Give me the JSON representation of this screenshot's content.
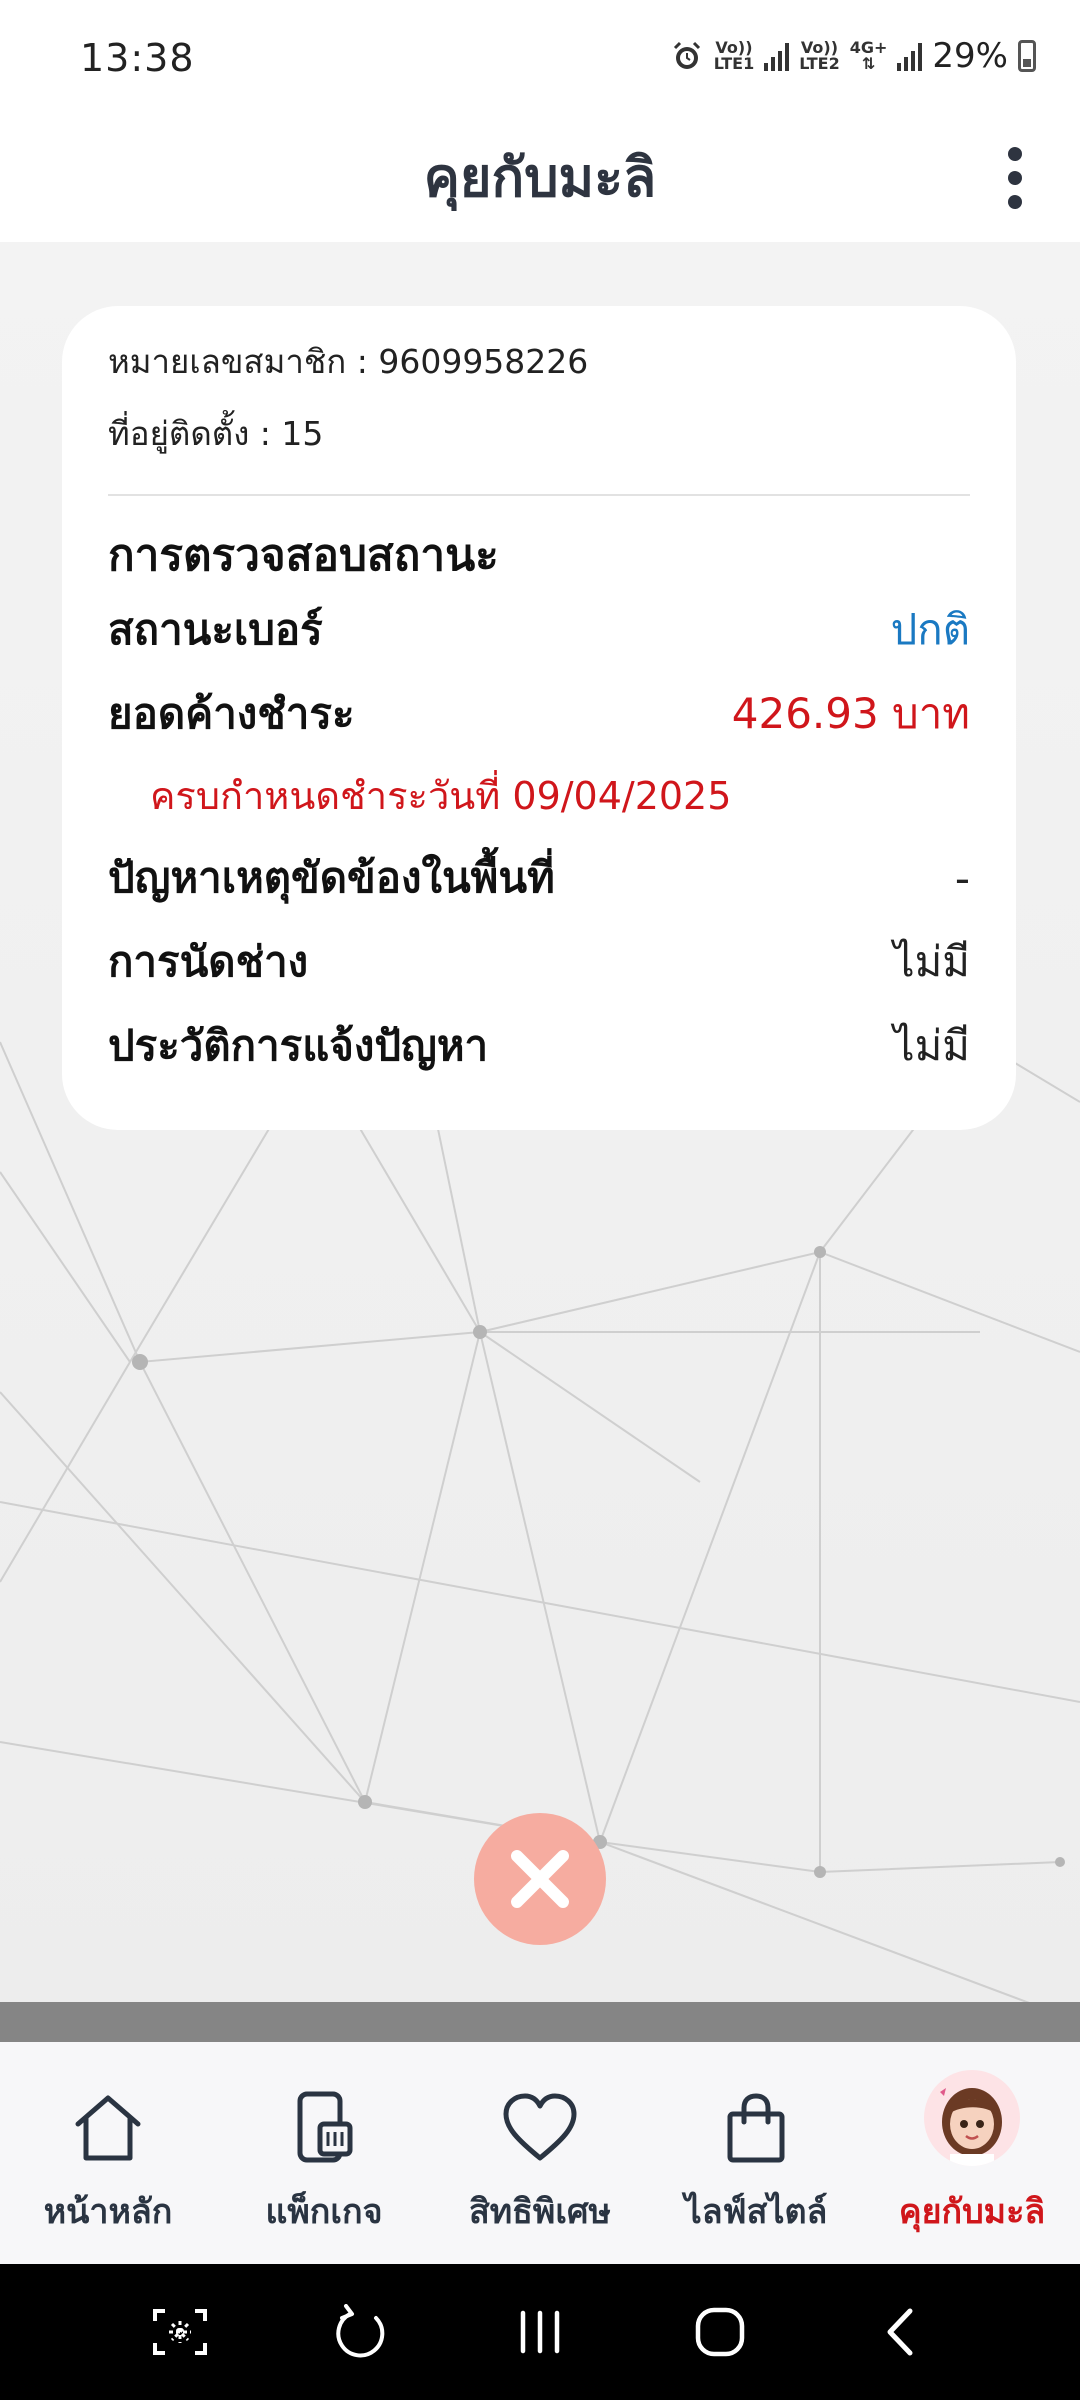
{
  "status_bar": {
    "time": "13:38",
    "lte1_top": "Vo))",
    "lte1_bottom": "LTE1",
    "lte2_top": "Vo))",
    "lte2_bottom": "LTE2",
    "network": "4G+",
    "battery": "29%"
  },
  "header": {
    "title": "คุยกับมะลิ",
    "menu_icon": "more-vertical-icon"
  },
  "card": {
    "member_line": "หมายเลขสมาชิก : 9609958226",
    "address_line": "ที่อยู่ติดตั้ง : 15",
    "section_title": "การตรวจสอบสถานะ",
    "rows": [
      {
        "label": "สถานะเบอร์",
        "value": "ปกติ"
      },
      {
        "label": "ยอดค้างชำระ",
        "value": "426.93 บาท"
      },
      {
        "label": "ปัญหาเหตุขัดข้องในพื้นที่",
        "value": "-"
      },
      {
        "label": "การนัดช่าง",
        "value": "ไม่มี"
      },
      {
        "label": "ประวัติการแจ้งปัญหา",
        "value": "ไม่มี"
      }
    ],
    "due_note": "ครบกำหนดชำระวันที่ 09/04/2025"
  },
  "close_button": {
    "icon": "close-icon"
  },
  "bottom_nav": {
    "items": [
      {
        "label": "หน้าหลัก",
        "icon": "home-icon"
      },
      {
        "label": "แพ็กเกจ",
        "icon": "phone-sim-icon"
      },
      {
        "label": "สิทธิพิเศษ",
        "icon": "heart-icon"
      },
      {
        "label": "ไลฟ์สไตล์",
        "icon": "shopping-bag-icon"
      },
      {
        "label": "คุยกับมะลิ",
        "icon": "avatar-icon"
      }
    ],
    "active_color": "#d0161b"
  },
  "system_nav": {
    "icons": [
      "screenshot-icon",
      "rotate-icon",
      "recents-icon",
      "home-circle-icon",
      "back-icon"
    ]
  },
  "colors": {
    "status_normal": "#1a79c2",
    "status_alert": "#d0161b",
    "close_button_bg": "#f6aca0"
  }
}
